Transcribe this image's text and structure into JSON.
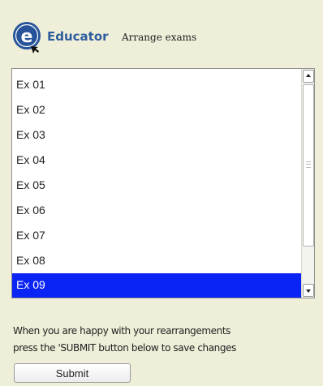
{
  "header": {
    "brand": "Educator",
    "title": "Arrange exams",
    "logo_letter": "e"
  },
  "exam_list": {
    "items": [
      {
        "label": "Ex 01",
        "selected": false
      },
      {
        "label": "Ex 02",
        "selected": false
      },
      {
        "label": "Ex 03",
        "selected": false
      },
      {
        "label": "Ex 04",
        "selected": false
      },
      {
        "label": "Ex 05",
        "selected": false
      },
      {
        "label": "Ex 06",
        "selected": false
      },
      {
        "label": "Ex 07",
        "selected": false
      },
      {
        "label": "Ex 08",
        "selected": false
      },
      {
        "label": "Ex 09",
        "selected": true
      }
    ]
  },
  "instructions": {
    "line1": "When you are happy with your rearrangements",
    "line2": "press the 'SUBMIT button below to save changes"
  },
  "submit": {
    "label": "Submit"
  },
  "colors": {
    "background": "#eeeed9",
    "brand": "#2e5d9d",
    "selection": "#0a24f5"
  }
}
